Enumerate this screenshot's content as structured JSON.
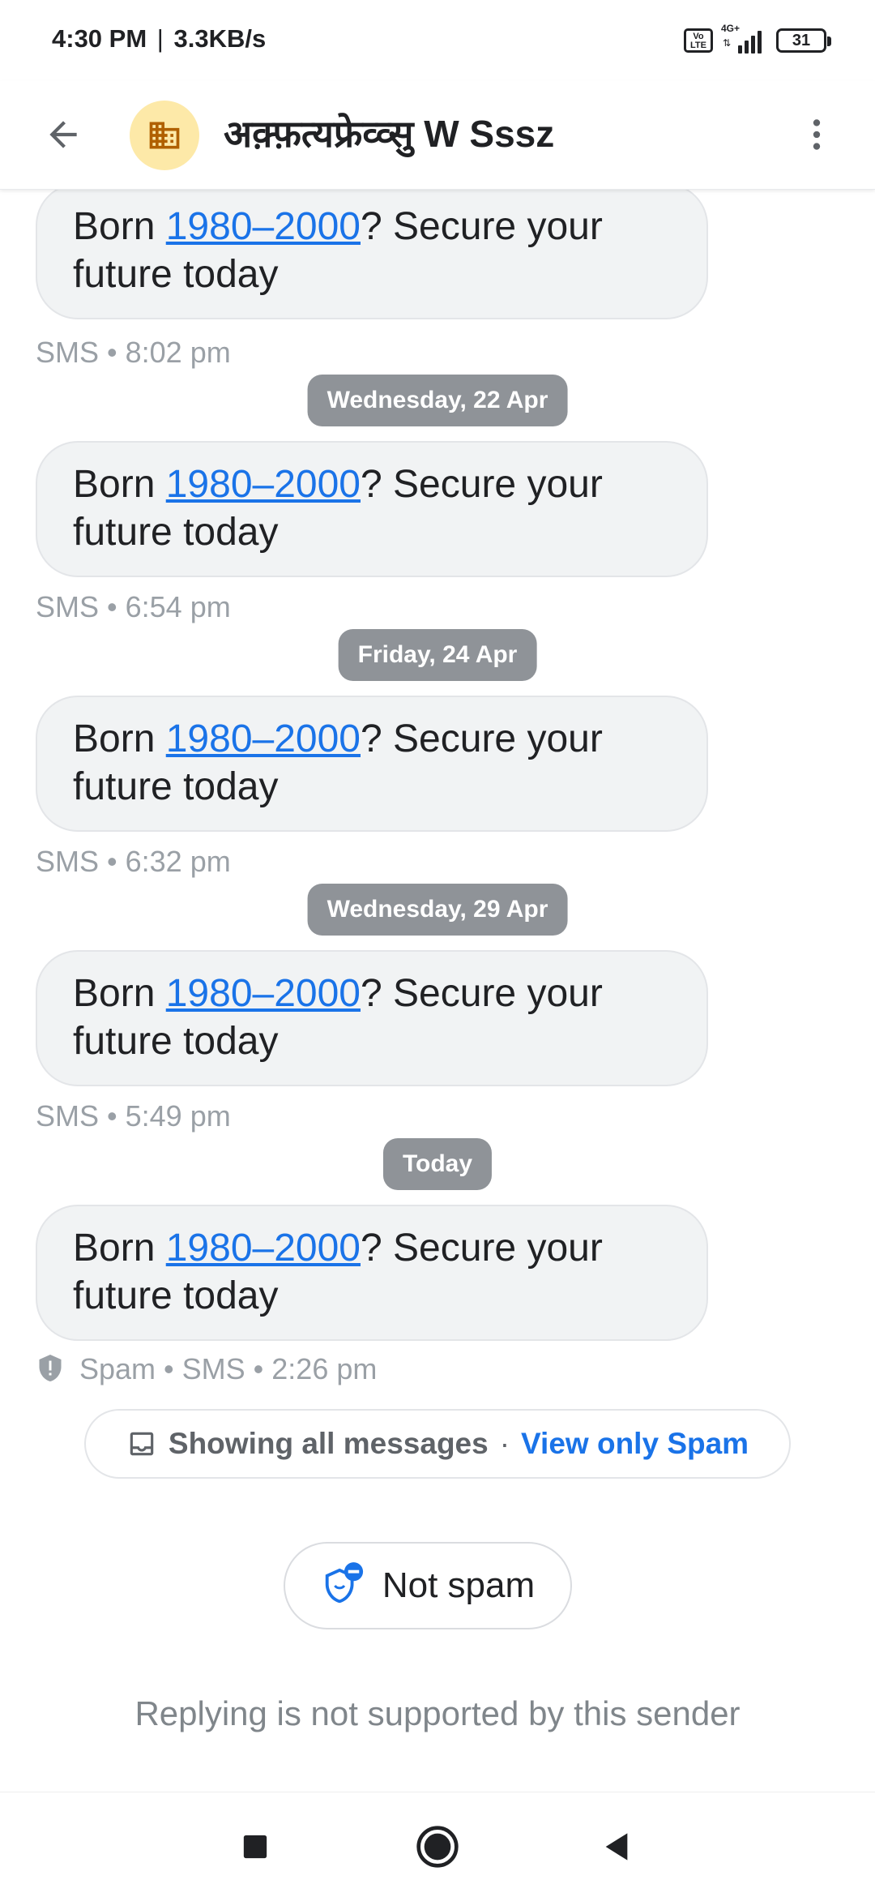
{
  "status_bar": {
    "time": "4:30 PM",
    "separator": "|",
    "speed": "3.3KB/s",
    "volte_top": "Vo",
    "volte_bottom": "LTE",
    "network": "4G+",
    "battery": "31"
  },
  "app_bar": {
    "title": "अक़्फ़त्यफ्रेव्व्सु W Sssz",
    "avatar_icon": "business-icon",
    "avatar_color": "#fde9a8",
    "icon_color": "#b06000"
  },
  "messages": [
    {
      "text_before": "Born ",
      "link": "1980–2000",
      "text_after": "? Secure your future today",
      "meta": "SMS • 8:02 pm"
    },
    {
      "text_before": "Born ",
      "link": "1980–2000",
      "text_after": "? Secure your future today",
      "meta": "SMS • 6:54 pm"
    },
    {
      "text_before": "Born ",
      "link": "1980–2000",
      "text_after": "? Secure your future today",
      "meta": "SMS • 6:32 pm"
    },
    {
      "text_before": "Born ",
      "link": "1980–2000",
      "text_after": "? Secure your future today",
      "meta": "SMS • 5:49 pm"
    },
    {
      "text_before": "Born ",
      "link": "1980–2000",
      "text_after": "? Secure your future today",
      "meta": "Spam • SMS • 2:26 pm"
    }
  ],
  "date_chips": [
    "Wednesday, 22 Apr",
    "Friday, 24 Apr",
    "Wednesday, 29 Apr",
    "Today"
  ],
  "filter": {
    "label": "Showing all messages",
    "dot": "·",
    "link": "View only Spam"
  },
  "not_spam": {
    "label": "Not spam"
  },
  "reply_note": "Replying is not supported by this sender",
  "colors": {
    "link": "#1a73e8",
    "bubble": "#f1f3f4",
    "chip": "#8f9398"
  }
}
